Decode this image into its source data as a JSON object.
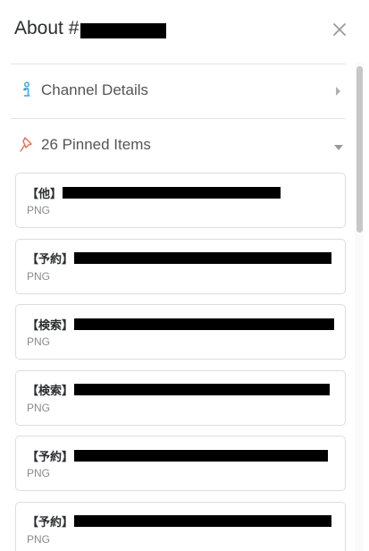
{
  "header": {
    "title": "About #",
    "close_icon": "close-icon"
  },
  "sections": {
    "channel_details": {
      "label": "Channel Details",
      "icon": "info-icon",
      "caret": "chevron-right-icon",
      "icon_color": "#3aa3e3"
    },
    "pinned": {
      "label": "26 Pinned Items",
      "icon": "pin-icon",
      "caret": "chevron-down-icon",
      "icon_color": "#e8735a"
    }
  },
  "pinned_items": [
    {
      "prefix": "【他】",
      "type": "PNG"
    },
    {
      "prefix": "【予約】",
      "type": "PNG"
    },
    {
      "prefix": "【検索】",
      "type": "PNG"
    },
    {
      "prefix": "【検索】",
      "type": "PNG"
    },
    {
      "prefix": "【予約】",
      "type": "PNG"
    },
    {
      "prefix": "【予約】",
      "type": "PNG"
    }
  ]
}
